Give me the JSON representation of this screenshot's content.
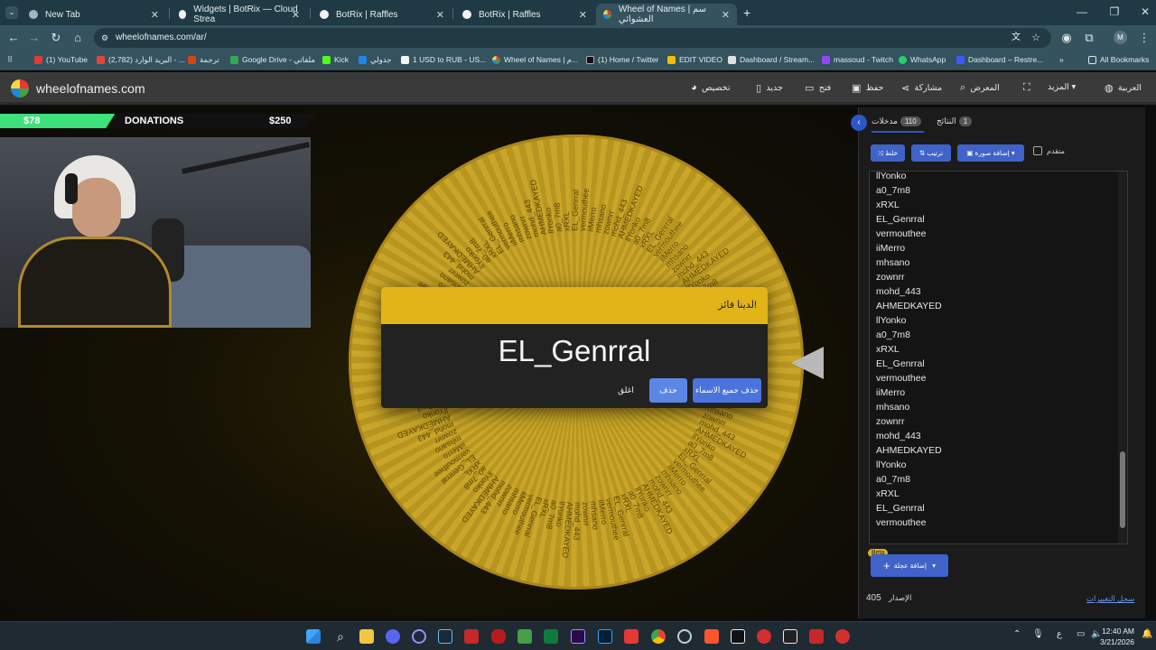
{
  "browser": {
    "tabs": [
      {
        "title": "New Tab",
        "active": false
      },
      {
        "title": "Widgets | BotRix — Cloud Strea",
        "active": false
      },
      {
        "title": "BotRix | Raffles",
        "active": false
      },
      {
        "title": "BotRix | Raffles",
        "active": false
      },
      {
        "title": "Wheel of Names | سم العشوائي",
        "active": true
      }
    ],
    "new_tab": "+",
    "url": "wheelofnames.com/ar/",
    "profile_initial": "M",
    "bookmarks": [
      "(1) YouTube",
      "(2,782) البريد الوارد - ...",
      "ترجمة",
      "Google Drive - ملفاتي",
      "Kick",
      "جدولي",
      "1 USD to RUB - US...",
      "Wheel of Names | م...",
      "(1) Home / Twitter",
      "EDIT VIDEO",
      "Dashboard / Stream...",
      "massoud - Twitch",
      "WhatsApp",
      "Dashboard – Restre..."
    ],
    "bookmarks_more": "»",
    "all_bookmarks": "All Bookmarks"
  },
  "site": {
    "logo_text": "wheelofnames.com",
    "menu": {
      "customize": "تخصيص",
      "new": "جديد",
      "open": "فتح",
      "save": "حفظ",
      "share": "مشاركة",
      "gallery": "المعرض",
      "more": "المزيد",
      "language": "العربية"
    }
  },
  "overlay": {
    "donations_label": "DONATIONS",
    "current": "$78",
    "goal": "$250",
    "progress": 0.312
  },
  "wheel": {
    "names": [
      "llYonko",
      "a0_7m8",
      "xRXL",
      "EL_Genrral",
      "vermouthee",
      "iiMerro",
      "mhsano",
      "zownrr",
      "mohd_443",
      "AHMEDKAYED"
    ]
  },
  "winner_dialog": {
    "title": "لدينا فائز!",
    "winner": "EL_Genrral",
    "close_label": "اغلق",
    "remove_label": "حذف",
    "remove_all_label": "حذف جميع الاسماء"
  },
  "panel": {
    "entries_tab": "مدخلات",
    "entries_count": "110",
    "results_tab": "النتائج",
    "results_count": "1",
    "shuffle": "خلط",
    "sort": "ترتيب",
    "add_image": "إضافة صورة",
    "advanced": "متقدم",
    "entries": [
      "llYonko",
      "a0_7m8",
      "xRXL",
      "EL_Genrral",
      "vermouthee",
      "iiMerro",
      "mhsano",
      "zownrr",
      "mohd_443",
      "AHMEDKAYED",
      "llYonko",
      "a0_7m8",
      "xRXL",
      "EL_Genrral",
      "vermouthee",
      "iiMerro",
      "mhsano",
      "zownrr",
      "mohd_443",
      "AHMEDKAYED",
      "llYonko",
      "a0_7m8",
      "xRXL",
      "EL_Genrral",
      "vermouthee"
    ],
    "beta_badge": "Beta",
    "add_wheel": "إضافة عجلة",
    "version_label": "الإصدار",
    "version": "405",
    "changelog": "سجل التغييرات"
  },
  "taskbar": {
    "time": "12:40 AM",
    "date": "3/21/2026",
    "lang": "ع"
  }
}
